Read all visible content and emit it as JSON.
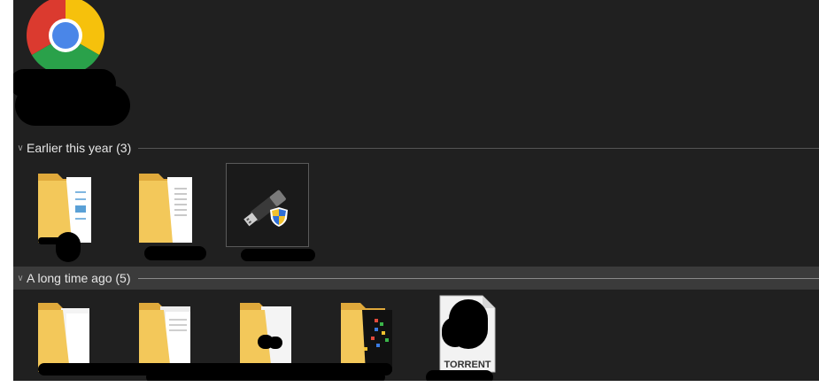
{
  "groups": [
    {
      "id": "earlier",
      "label": "Earlier this year (3)"
    },
    {
      "id": "long_ago",
      "label": "A long time ago (5)"
    }
  ],
  "items": {
    "torrent_label": "TORRENT"
  },
  "icons": {
    "chrome": "chrome-icon",
    "folder": "folder-icon",
    "usb": "usb-drive-icon",
    "shield": "uac-shield-icon",
    "torrent": "torrent-file-icon"
  },
  "colors": {
    "background": "#202020",
    "folder_yellow": "#f3c85a",
    "header_hover": "#3b3b3b"
  }
}
